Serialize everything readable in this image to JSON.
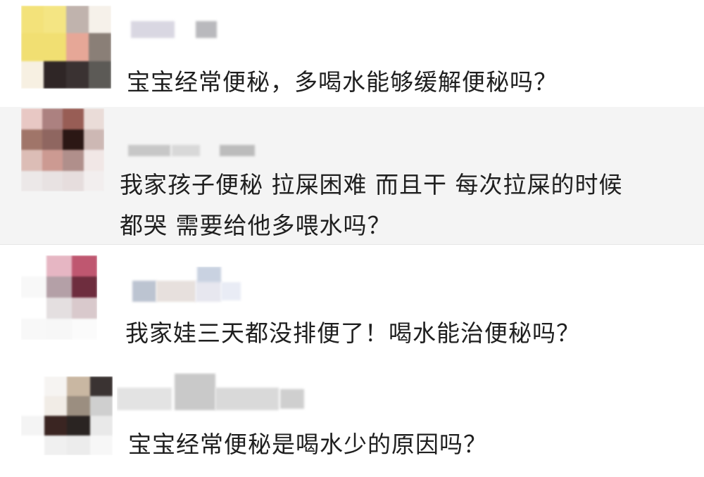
{
  "comments": [
    {
      "id": "comment-1",
      "text": "宝宝经常便秘，多喝水能够缓解便秘吗？",
      "avatar_colors": [
        "#f3e27a",
        "#f4e583",
        "#c0b3ad",
        "#f6f1ea",
        "#f1df72",
        "#f1df72",
        "#e6a797",
        "#8a7f77",
        "#f7f0e2",
        "#2f2626",
        "#3a3232",
        "#5c5a56"
      ],
      "name_colors": [
        "#d9d7e2",
        "#b9b9bd"
      ]
    },
    {
      "id": "comment-2",
      "text": "我家孩子便秘 拉屎困难 而且干 每次拉屎的时候\n都哭 需要给他多喂水吗？",
      "avatar_colors": [
        "#e8c8c4",
        "#ac8180",
        "#985d55",
        "#eadcd8",
        "#a07569",
        "#8f6660",
        "#2b1714",
        "#cdb8b4",
        "#dcbdb6",
        "#cc9a92",
        "#b08f8b",
        "#f1e7e6",
        "#ece8e8",
        "#e8e2e2",
        "#e6dddd",
        "#f2eeee"
      ],
      "name_colors": [
        "#c7c7c7",
        "#d8d8d8",
        "#bcbcbc"
      ]
    },
    {
      "id": "comment-3",
      "text": "我家娃三天都没排便了！喝水能治便秘吗？",
      "avatar_colors": [
        "#ffffff",
        "#e6b6c3",
        "#bf5770",
        "#f8f8f8",
        "#b4a0a7",
        "#6e2d3e",
        "#ffffff",
        "#e4dfe0",
        "#d9c9cc",
        "#f8f8f8",
        "#f7f7f7",
        "#fbfbfb"
      ],
      "name_colors": [
        "#bcc4d1",
        "#e7e0dd",
        "#e7e7ef",
        "#c9d2e1",
        "#e9ecf5"
      ]
    },
    {
      "id": "comment-4",
      "text": "宝宝经常便秘是喝水少的原因吗？",
      "avatar_colors": [
        "#ffffff",
        "#f6f4f2",
        "#c9b7a2",
        "#3a3332",
        "#ffffff",
        "#f1ece6",
        "#9b8e80",
        "#cfcfcf",
        "#f4f4f4",
        "#3a2522",
        "#2a2422",
        "#e9e9e9",
        "#ffffff",
        "#f0f0f0",
        "#ececec",
        "#f7f7f7"
      ],
      "name_colors": [
        "#e3e3e3",
        "#c9c9c9",
        "#d9d9d9",
        "#cfcfcf"
      ]
    }
  ]
}
